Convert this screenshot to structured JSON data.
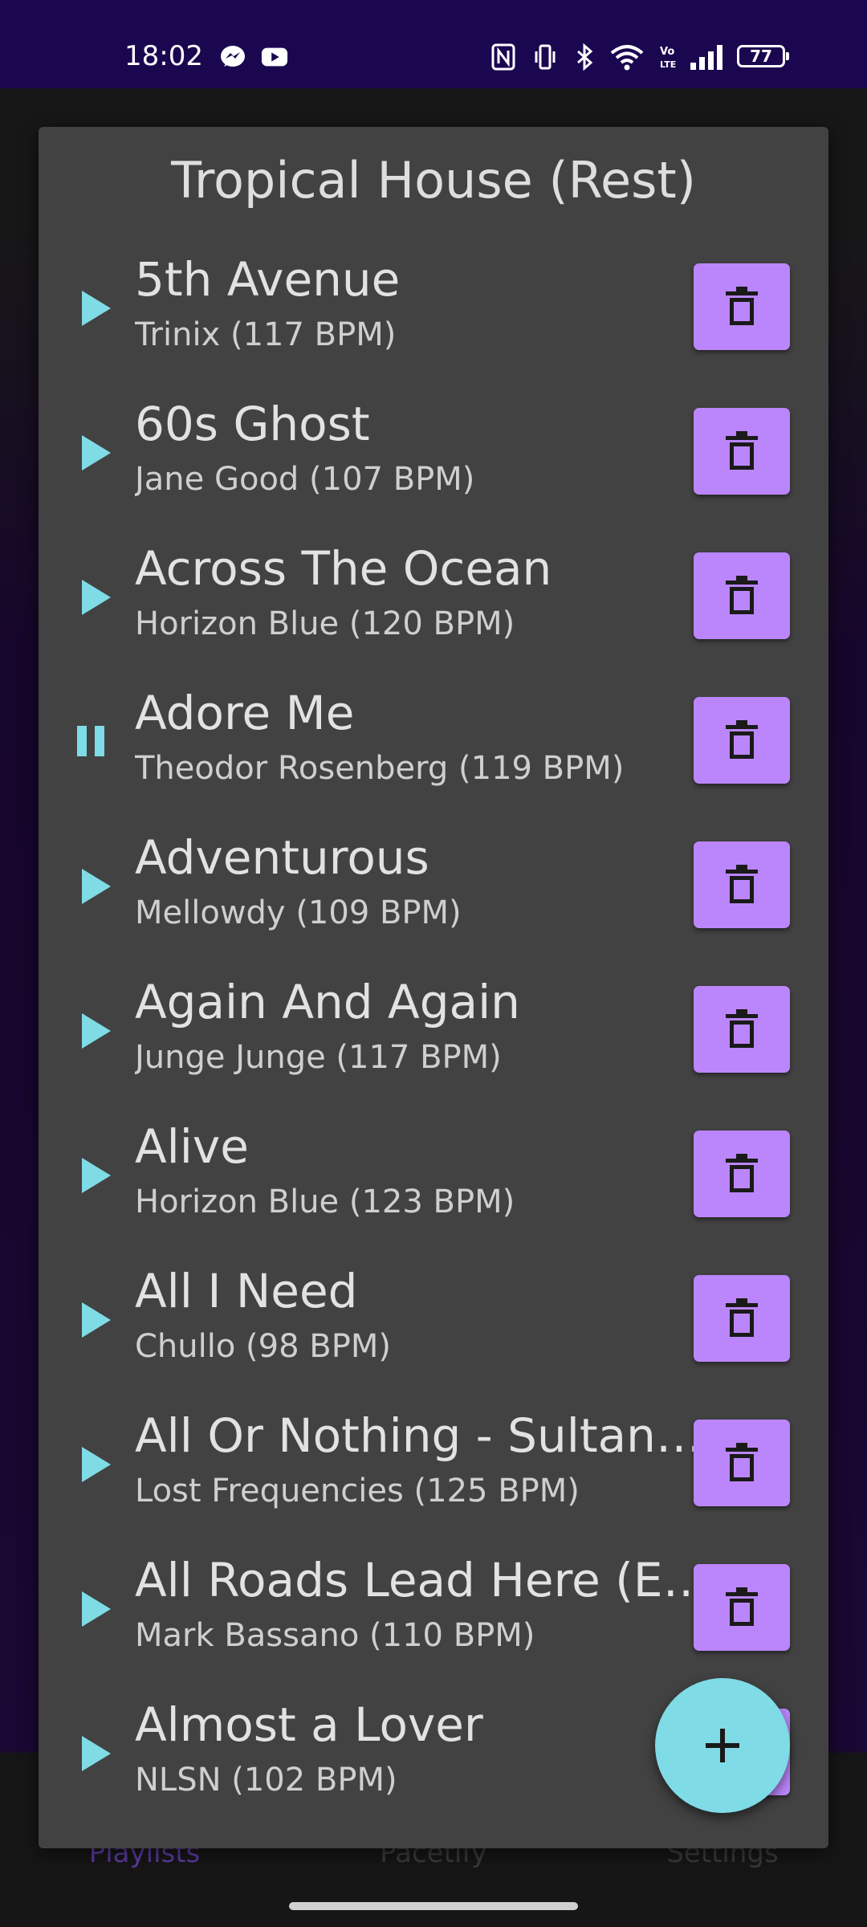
{
  "status_bar": {
    "time": "18:02",
    "battery": "77",
    "left_icons": [
      "messenger-icon",
      "youtube-icon"
    ],
    "right_icons": [
      "nfc-icon",
      "vibrate-icon",
      "bluetooth-icon",
      "wifi-icon",
      "volte-icon",
      "signal-icon",
      "battery-icon"
    ]
  },
  "dialog": {
    "title": "Tropical House (Rest)"
  },
  "songs": [
    {
      "title": "5th Avenue",
      "subtitle": "Trinix (117 BPM)",
      "state": "play"
    },
    {
      "title": "60s Ghost",
      "subtitle": "Jane Good (107 BPM)",
      "state": "play"
    },
    {
      "title": "Across The Ocean",
      "subtitle": "Horizon Blue (120 BPM)",
      "state": "play"
    },
    {
      "title": "Adore Me",
      "subtitle": "Theodor Rosenberg (119 BPM)",
      "state": "pause"
    },
    {
      "title": "Adventurous",
      "subtitle": "Mellowdy (109 BPM)",
      "state": "play"
    },
    {
      "title": "Again And Again",
      "subtitle": "Junge Junge (117 BPM)",
      "state": "play"
    },
    {
      "title": "Alive",
      "subtitle": "Horizon Blue (123 BPM)",
      "state": "play"
    },
    {
      "title": "All I Need",
      "subtitle": "Chullo (98 BPM)",
      "state": "play"
    },
    {
      "title": "All Or Nothing - Sultan …",
      "subtitle": "Lost Frequencies (125 BPM)",
      "state": "play"
    },
    {
      "title": "All Roads Lead Here (E…",
      "subtitle": "Mark Bassano (110 BPM)",
      "state": "play"
    },
    {
      "title": "Almost a Lover",
      "subtitle": "NLSN (102 BPM)",
      "state": "play"
    }
  ],
  "bottom_nav": {
    "items": [
      {
        "label": "Playlists",
        "color": "#5b3aa0"
      },
      {
        "label": "Pacetify",
        "color": "#3a3a3a"
      },
      {
        "label": "Settings",
        "color": "#3a3a3a"
      }
    ]
  },
  "colors": {
    "status_bar": "#1b0750",
    "dialog_bg": "#424242",
    "accent_purple": "#bb86fc",
    "accent_teal": "#7fdbe6"
  },
  "fab": {
    "icon": "plus-icon"
  }
}
